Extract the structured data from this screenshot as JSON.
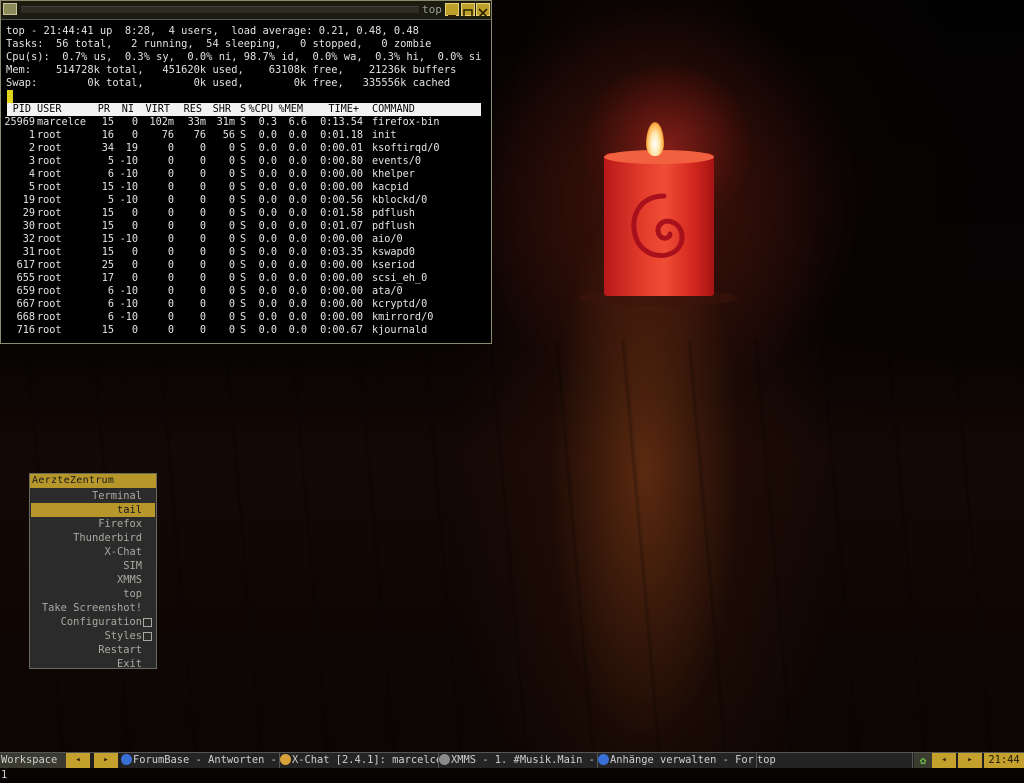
{
  "window": {
    "title": "top",
    "summary_lines": [
      "top - 21:44:41 up  8:28,  4 users,  load average: 0.21, 0.48, 0.48",
      "Tasks:  56 total,   2 running,  54 sleeping,   0 stopped,   0 zombie",
      "Cpu(s):  0.7% us,  0.3% sy,  0.0% ni, 98.7% id,  0.0% wa,  0.3% hi,  0.0% si",
      "Mem:    514728k total,   451620k used,    63108k free,    21236k buffers",
      "Swap:        0k total,        0k used,        0k free,   335556k cached"
    ],
    "columns": [
      "PID",
      "USER",
      "PR",
      "NI",
      "VIRT",
      "RES",
      "SHR",
      "S",
      "%CPU",
      "%MEM",
      "TIME+",
      "COMMAND"
    ],
    "processes": [
      [
        "25969",
        "marcelce",
        "15",
        "0",
        "102m",
        "33m",
        "31m",
        "S",
        "0.3",
        "6.6",
        "0:13.54",
        "firefox-bin"
      ],
      [
        "1",
        "root",
        "16",
        "0",
        "76",
        "76",
        "56",
        "S",
        "0.0",
        "0.0",
        "0:01.18",
        "init"
      ],
      [
        "2",
        "root",
        "34",
        "19",
        "0",
        "0",
        "0",
        "S",
        "0.0",
        "0.0",
        "0:00.01",
        "ksoftirqd/0"
      ],
      [
        "3",
        "root",
        "5",
        "-10",
        "0",
        "0",
        "0",
        "S",
        "0.0",
        "0.0",
        "0:00.80",
        "events/0"
      ],
      [
        "4",
        "root",
        "6",
        "-10",
        "0",
        "0",
        "0",
        "S",
        "0.0",
        "0.0",
        "0:00.00",
        "khelper"
      ],
      [
        "5",
        "root",
        "15",
        "-10",
        "0",
        "0",
        "0",
        "S",
        "0.0",
        "0.0",
        "0:00.00",
        "kacpid"
      ],
      [
        "19",
        "root",
        "5",
        "-10",
        "0",
        "0",
        "0",
        "S",
        "0.0",
        "0.0",
        "0:00.56",
        "kblockd/0"
      ],
      [
        "29",
        "root",
        "15",
        "0",
        "0",
        "0",
        "0",
        "S",
        "0.0",
        "0.0",
        "0:01.58",
        "pdflush"
      ],
      [
        "30",
        "root",
        "15",
        "0",
        "0",
        "0",
        "0",
        "S",
        "0.0",
        "0.0",
        "0:01.07",
        "pdflush"
      ],
      [
        "32",
        "root",
        "15",
        "-10",
        "0",
        "0",
        "0",
        "S",
        "0.0",
        "0.0",
        "0:00.00",
        "aio/0"
      ],
      [
        "31",
        "root",
        "15",
        "0",
        "0",
        "0",
        "0",
        "S",
        "0.0",
        "0.0",
        "0:03.35",
        "kswapd0"
      ],
      [
        "617",
        "root",
        "25",
        "0",
        "0",
        "0",
        "0",
        "S",
        "0.0",
        "0.0",
        "0:00.00",
        "kseriod"
      ],
      [
        "655",
        "root",
        "17",
        "0",
        "0",
        "0",
        "0",
        "S",
        "0.0",
        "0.0",
        "0:00.00",
        "scsi_eh_0"
      ],
      [
        "659",
        "root",
        "6",
        "-10",
        "0",
        "0",
        "0",
        "S",
        "0.0",
        "0.0",
        "0:00.00",
        "ata/0"
      ],
      [
        "667",
        "root",
        "6",
        "-10",
        "0",
        "0",
        "0",
        "S",
        "0.0",
        "0.0",
        "0:00.00",
        "kcryptd/0"
      ],
      [
        "668",
        "root",
        "6",
        "-10",
        "0",
        "0",
        "0",
        "S",
        "0.0",
        "0.0",
        "0:00.00",
        "kmirrord/0"
      ],
      [
        "716",
        "root",
        "15",
        "0",
        "0",
        "0",
        "0",
        "S",
        "0.0",
        "0.0",
        "0:00.67",
        "kjournald"
      ]
    ]
  },
  "menu": {
    "title": "AerzteZentrum",
    "items": [
      {
        "label": "Terminal",
        "selected": false,
        "submenu": false
      },
      {
        "label": "tail",
        "selected": true,
        "submenu": false
      },
      {
        "label": "Firefox",
        "selected": false,
        "submenu": false
      },
      {
        "label": "Thunderbird",
        "selected": false,
        "submenu": false
      },
      {
        "label": "X-Chat",
        "selected": false,
        "submenu": false
      },
      {
        "label": "SIM",
        "selected": false,
        "submenu": false
      },
      {
        "label": "XMMS",
        "selected": false,
        "submenu": false
      },
      {
        "label": "top",
        "selected": false,
        "submenu": false
      },
      {
        "label": "Take Screenshot!",
        "selected": false,
        "submenu": false
      },
      {
        "label": "Configuration",
        "selected": false,
        "submenu": true
      },
      {
        "label": "Styles",
        "selected": false,
        "submenu": true
      },
      {
        "label": "Restart",
        "selected": false,
        "submenu": false
      },
      {
        "label": "Exit",
        "selected": false,
        "submenu": false
      }
    ]
  },
  "toolbar": {
    "workspace": "Workspace 1",
    "prev_arrow": "◂",
    "next_arrow": "▸",
    "tasks": [
      {
        "label": "ForumBase - Antworten -",
        "icon": "firefox-icon",
        "icon_color": "#3a6fd8"
      },
      {
        "label": "X-Chat [2.4.1]: marcelce",
        "icon": "xchat-icon",
        "icon_color": "#d8a23a"
      },
      {
        "label": "XMMS - 1. #Musik.Main -",
        "icon": "xmms-icon",
        "icon_color": "#8a8a8a"
      },
      {
        "label": "Anhänge verwalten - For",
        "icon": "thunderbird-icon",
        "icon_color": "#3a6fd8"
      },
      {
        "label": "top",
        "icon": "",
        "icon_color": ""
      }
    ],
    "tray_icon": "network-icon",
    "clock": "21:44",
    "accent": "#c4a12c"
  }
}
